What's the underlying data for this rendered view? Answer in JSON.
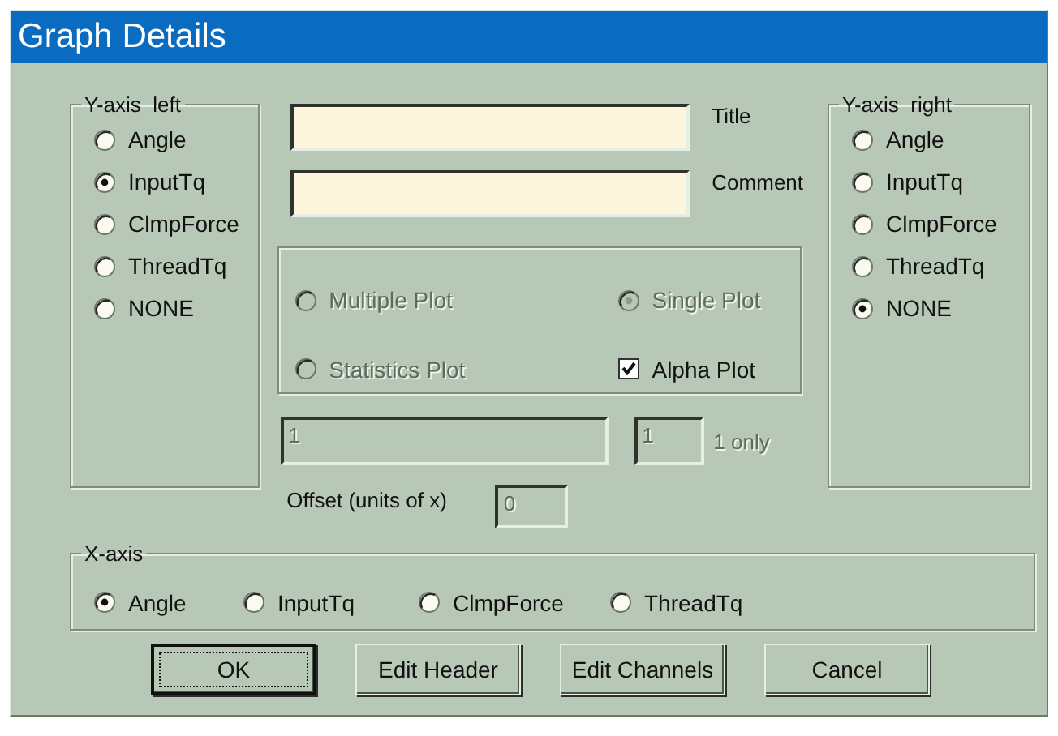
{
  "window": {
    "title": "Graph Details"
  },
  "y_axis_left": {
    "label": "Y-axis  left",
    "options": [
      {
        "label": "Angle",
        "selected": false
      },
      {
        "label": "InputTq",
        "selected": true
      },
      {
        "label": "ClmpForce",
        "selected": false
      },
      {
        "label": "ThreadTq",
        "selected": false
      },
      {
        "label": "NONE",
        "selected": false
      }
    ]
  },
  "text_fields": [
    {
      "label": "Title"
    },
    {
      "label": "Comment"
    }
  ],
  "plot_options": [
    {
      "kind": "radio",
      "label": "Multiple Plot",
      "selected": false,
      "disabled": true
    },
    {
      "kind": "radio",
      "label": "Single Plot",
      "selected": true,
      "disabled": true
    },
    {
      "kind": "radio",
      "label": "Statistics Plot",
      "selected": false,
      "disabled": true
    },
    {
      "kind": "checkbox",
      "label": "Alpha Plot",
      "checked": true,
      "disabled": false
    }
  ],
  "range": {
    "from": {
      "value": "1",
      "disabled": true
    },
    "to": {
      "value": "1",
      "disabled": true
    },
    "note": {
      "text": "1 only",
      "disabled": true
    }
  },
  "offset": {
    "label": "Offset (units of x)",
    "value": "0",
    "disabled": true
  },
  "y_axis_right": {
    "label": "Y-axis  right",
    "options": [
      {
        "label": "Angle",
        "selected": false
      },
      {
        "label": "InputTq",
        "selected": false
      },
      {
        "label": "ClmpForce",
        "selected": false
      },
      {
        "label": "ThreadTq",
        "selected": false
      },
      {
        "label": "NONE",
        "selected": true
      }
    ]
  },
  "x_axis": {
    "label": "X-axis",
    "options": [
      {
        "label": "Angle",
        "selected": true
      },
      {
        "label": "InputTq",
        "selected": false
      },
      {
        "label": "ClmpForce",
        "selected": false
      },
      {
        "label": "ThreadTq",
        "selected": false
      }
    ]
  },
  "buttons": [
    {
      "label": "OK",
      "default": true
    },
    {
      "label": "Edit Header",
      "default": false
    },
    {
      "label": "Edit Channels",
      "default": false
    },
    {
      "label": "Cancel",
      "default": false
    }
  ]
}
